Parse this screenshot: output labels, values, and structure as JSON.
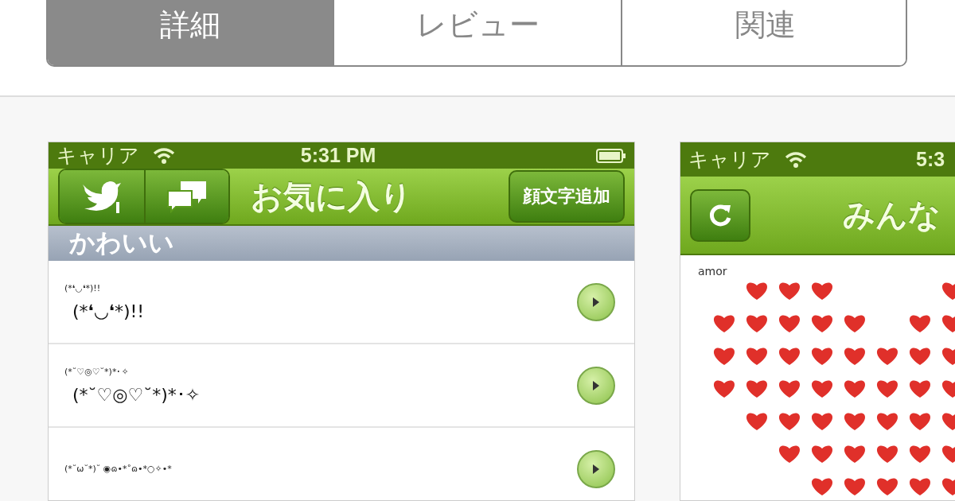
{
  "tabs": [
    {
      "label": "詳細",
      "selected": true
    },
    {
      "label": "レビュー",
      "selected": false
    },
    {
      "label": "関連",
      "selected": false
    }
  ],
  "screenshots": [
    {
      "status_bar": {
        "carrier": "キャリア",
        "time": "5:31 PM"
      },
      "nav_bar": {
        "title": "お気に入り",
        "action": "顔文字追加"
      },
      "section": "かわいい",
      "rows": [
        {
          "small": "(*❛◡❛*)!!",
          "large": "(*❛◡❛*)!!"
        },
        {
          "small": "(*˘♡◎♡˘*)*･✧",
          "large": "(*˘♡◎♡˘*)*･✧"
        },
        {
          "small": "(*˘ω˘*)˘ ◉ɷ•*˚ɷ•*○✧•*"
        }
      ]
    },
    {
      "status_bar": {
        "carrier": "キャリア",
        "time": "5:3"
      },
      "nav_bar": {
        "title": "みんな"
      },
      "content_label": "amor"
    }
  ]
}
